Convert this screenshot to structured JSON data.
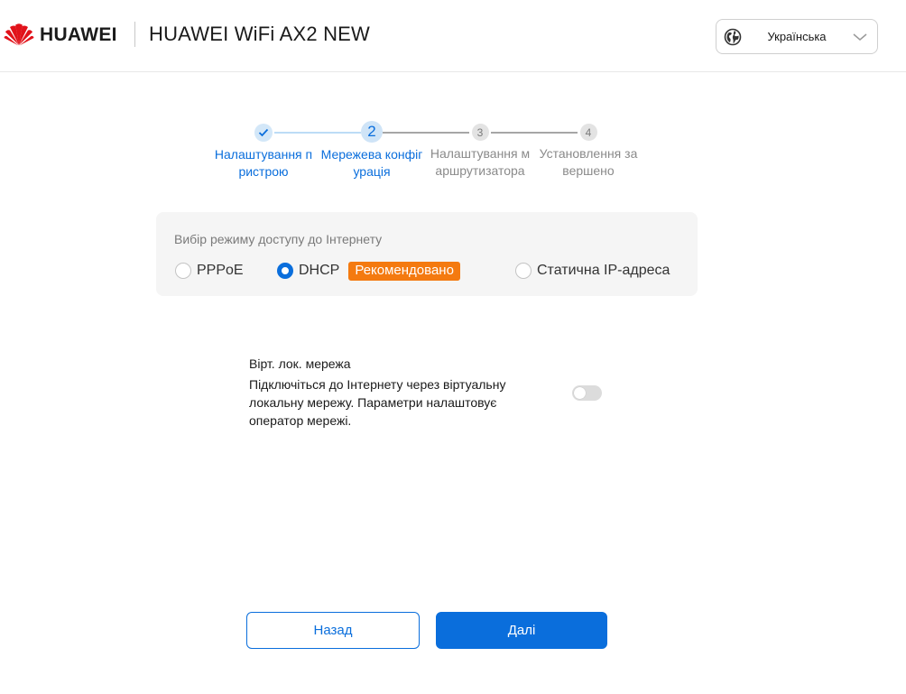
{
  "header": {
    "brand": "HUAWEI",
    "product": "HUAWEI WiFi AX2 NEW",
    "language": "Українська",
    "icons": {
      "logo": "huawei-flower-logo",
      "globe": "globe-icon",
      "chevron": "chevron-down-icon"
    }
  },
  "stepper": {
    "current_step": 2,
    "steps": [
      {
        "number": "1",
        "label": "Налаштування пристрою",
        "state": "done"
      },
      {
        "number": "2",
        "label": "Мережева конфігурація",
        "state": "current"
      },
      {
        "number": "3",
        "label": "Налаштування маршрутизатора",
        "state": "todo"
      },
      {
        "number": "4",
        "label": "Установлення завершено",
        "state": "todo"
      }
    ]
  },
  "access_mode": {
    "title": "Вибір режиму доступу до Інтернету",
    "options": [
      {
        "label": "PPPoE",
        "checked": false
      },
      {
        "label": "DHCP",
        "checked": true,
        "badge": "Рекомендовано"
      },
      {
        "label": "Статична IP-адреса",
        "checked": false
      }
    ]
  },
  "vlan": {
    "title": "Вірт. лок. мережа",
    "description": "Підключіться до Інтернету через віртуальну локальну мережу. Параметри налаштовує оператор мережі.",
    "enabled": false
  },
  "buttons": {
    "back": "Назад",
    "next": "Далі"
  },
  "colors": {
    "accent": "#0a6edc",
    "badge": "#f47a10",
    "brand_red": "#e1121a",
    "inactive": "#8a8a8a"
  }
}
